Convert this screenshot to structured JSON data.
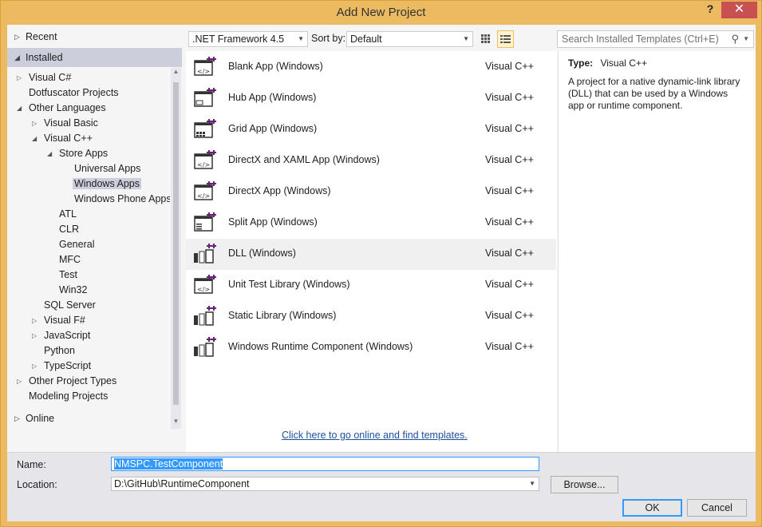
{
  "window": {
    "title": "Add New Project",
    "help_label": "?",
    "close_label": "✕"
  },
  "tree": {
    "recent_label": "Recent",
    "installed_label": "Installed",
    "online_label": "Online",
    "items": [
      {
        "label": "Visual C#",
        "expander": "▷"
      },
      {
        "label": "Dotfuscator Projects",
        "expander": ""
      },
      {
        "label": "Other Languages",
        "expander": "◢"
      },
      {
        "label": "Visual Basic",
        "expander": "▷"
      },
      {
        "label": "Visual C++",
        "expander": "◢"
      },
      {
        "label": "Store Apps",
        "expander": "◢"
      },
      {
        "label": "Universal Apps",
        "expander": ""
      },
      {
        "label": "Windows Apps",
        "expander": ""
      },
      {
        "label": "Windows Phone Apps",
        "expander": ""
      },
      {
        "label": "ATL",
        "expander": ""
      },
      {
        "label": "CLR",
        "expander": ""
      },
      {
        "label": "General",
        "expander": ""
      },
      {
        "label": "MFC",
        "expander": ""
      },
      {
        "label": "Test",
        "expander": ""
      },
      {
        "label": "Win32",
        "expander": ""
      },
      {
        "label": "SQL Server",
        "expander": ""
      },
      {
        "label": "Visual F#",
        "expander": "▷"
      },
      {
        "label": "JavaScript",
        "expander": "▷"
      },
      {
        "label": "Python",
        "expander": ""
      },
      {
        "label": "TypeScript",
        "expander": "▷"
      },
      {
        "label": "Other Project Types",
        "expander": "▷"
      },
      {
        "label": "Modeling Projects",
        "expander": ""
      }
    ]
  },
  "toolbar": {
    "framework": ".NET Framework 4.5",
    "sort_label": "Sort by:",
    "sort_value": "Default",
    "search_placeholder": "Search Installed Templates (Ctrl+E)"
  },
  "templates": [
    {
      "name": "Blank App (Windows)",
      "lang": "Visual C++",
      "icon": "blank-app-icon"
    },
    {
      "name": "Hub App (Windows)",
      "lang": "Visual C++",
      "icon": "hub-app-icon"
    },
    {
      "name": "Grid App (Windows)",
      "lang": "Visual C++",
      "icon": "grid-app-icon"
    },
    {
      "name": "DirectX and XAML App (Windows)",
      "lang": "Visual C++",
      "icon": "directx-xaml-app-icon"
    },
    {
      "name": "DirectX App (Windows)",
      "lang": "Visual C++",
      "icon": "directx-app-icon"
    },
    {
      "name": "Split App (Windows)",
      "lang": "Visual C++",
      "icon": "split-app-icon"
    },
    {
      "name": "DLL (Windows)",
      "lang": "Visual C++",
      "icon": "dll-icon"
    },
    {
      "name": "Unit Test Library (Windows)",
      "lang": "Visual C++",
      "icon": "unit-test-icon"
    },
    {
      "name": "Static Library (Windows)",
      "lang": "Visual C++",
      "icon": "static-library-icon"
    },
    {
      "name": "Windows Runtime Component (Windows)",
      "lang": "Visual C++",
      "icon": "runtime-component-icon"
    }
  ],
  "online_link": "Click here to go online and find templates.",
  "details": {
    "type_label": "Type:",
    "type_value": "Visual C++",
    "description": "A project for a native dynamic-link library (DLL) that can be used by a Windows app or runtime component."
  },
  "form": {
    "name_label": "Name:",
    "name_value": "NMSPC.TestComponent",
    "location_label": "Location:",
    "location_value": "D:\\GitHub\\RuntimeComponent",
    "browse_label": "Browse...",
    "ok_label": "OK",
    "cancel_label": "Cancel"
  },
  "colors": {
    "chrome": "#ebba61",
    "close": "#c75050",
    "selection": "#cccedb",
    "link": "#1e50a2",
    "icon_accent": "#68217a"
  }
}
